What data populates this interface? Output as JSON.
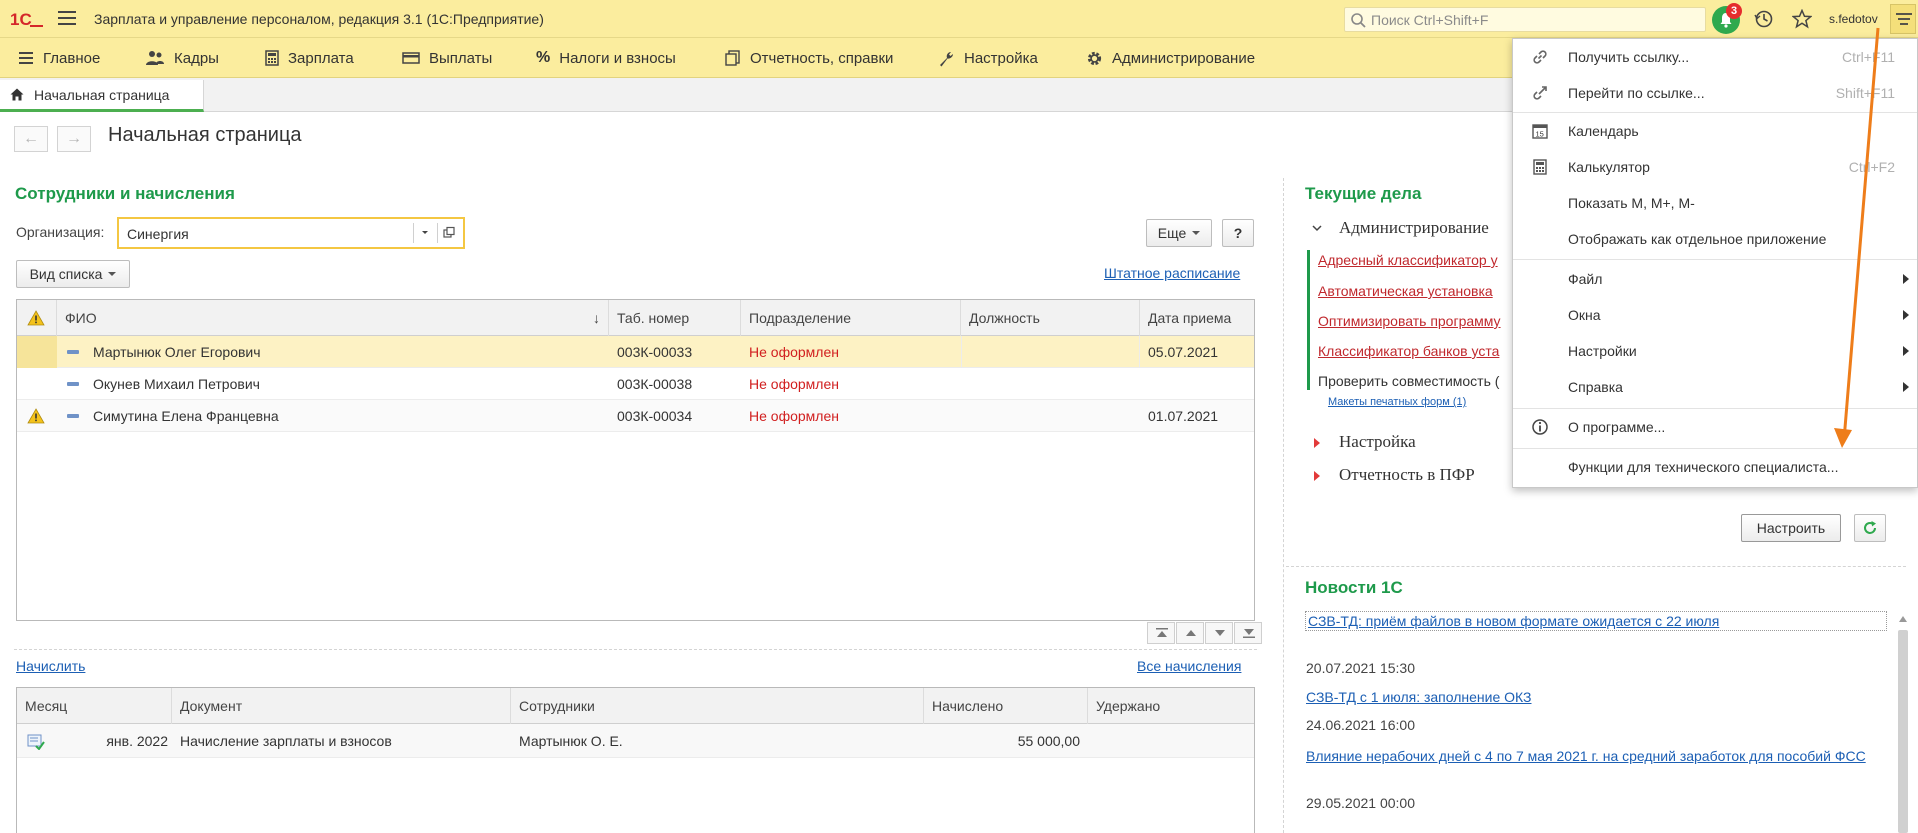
{
  "titlebar": {
    "app_title": "Зарплата и управление персоналом, редакция 3.1  (1С:Предприятие)",
    "search_placeholder": "Поиск Ctrl+Shift+F",
    "notifications_count": "3",
    "username": "s.fedotov"
  },
  "sections": [
    {
      "label": "Главное",
      "icon": "menu-lines-icon"
    },
    {
      "label": "Кадры",
      "icon": "people-icon"
    },
    {
      "label": "Зарплата",
      "icon": "calculator-icon"
    },
    {
      "label": "Выплаты",
      "icon": "card-icon"
    },
    {
      "label": "Налоги и взносы",
      "icon": "percent-icon"
    },
    {
      "label": "Отчетность, справки",
      "icon": "documents-icon"
    },
    {
      "label": "Настройка",
      "icon": "wrench-icon"
    },
    {
      "label": "Администрирование",
      "icon": "gear-icon"
    }
  ],
  "tab": {
    "label": "Начальная страница"
  },
  "page": {
    "title": "Начальная страница"
  },
  "employees": {
    "section_title": "Сотрудники и начисления",
    "org_label": "Организация:",
    "org_value": "Синергия",
    "more_label": "Еще",
    "help_label": "?",
    "view_label": "Вид списка",
    "staff_link": "Штатное расписание",
    "columns": [
      "ФИО",
      "Таб. номер",
      "Подразделение",
      "Должность",
      "Дата приема"
    ],
    "sort_indicator": "↓",
    "rows": [
      {
        "name": "Мартынюк Олег Егорович",
        "tab": "003К-00033",
        "dept": "Не оформлен",
        "position": "",
        "date": "05.07.2021",
        "warning": false
      },
      {
        "name": "Окунев Михаил Петрович",
        "tab": "003К-00038",
        "dept": "Не оформлен",
        "position": "",
        "date": "",
        "warning": false
      },
      {
        "name": "Симутина Елена Францевна",
        "tab": "003К-00034",
        "dept": "Не оформлен",
        "position": "",
        "date": "01.07.2021",
        "warning": true
      }
    ]
  },
  "accruals": {
    "accrue_link": "Начислить",
    "all_link": "Все начисления",
    "columns": [
      "Месяц",
      "Документ",
      "Сотрудники",
      "Начислено",
      "Удержано"
    ],
    "rows": [
      {
        "month": "янв. 2022",
        "document": "Начисление зарплаты и взносов",
        "employees": "Мартынюк О. Е.",
        "accrued": "55 000,00",
        "withheld": ""
      }
    ]
  },
  "tasks": {
    "section_title": "Текущие дела",
    "admin_group": "Администрирование",
    "admin_items": [
      "Адресный классификатор у",
      "Автоматическая установка",
      "Оптимизировать программу",
      "Классификатор банков уста"
    ],
    "check_compat": "Проверить совместимость (",
    "print_forms": "Макеты печатных форм (1)",
    "settings_group": "Настройка",
    "pfr_group": "Отчетность в ПФР",
    "configure_label": "Настроить"
  },
  "news": {
    "section_title": "Новости 1С",
    "items": [
      {
        "title": "СЗВ-ТД: приём файлов в новом формате ожидается с 22 июля",
        "date": "20.07.2021 15:30"
      },
      {
        "title": "СЗВ-ТД с 1 июля: заполнение ОКЗ",
        "date": "24.06.2021 16:00"
      },
      {
        "title": "Влияние нерабочих дней с 4 по 7 мая 2021 г. на средний заработок для пособий ФСС",
        "date": "29.05.2021 00:00"
      }
    ]
  },
  "menu": {
    "items": [
      {
        "label": "Получить ссылку...",
        "shortcut": "Ctrl+F11",
        "icon": "link-icon"
      },
      {
        "label": "Перейти по ссылке...",
        "shortcut": "Shift+F11",
        "icon": "goto-link-icon"
      },
      {
        "label": "Календарь",
        "shortcut": "",
        "icon": "calendar-icon"
      },
      {
        "label": "Калькулятор",
        "shortcut": "Ctrl+F2",
        "icon": "calculator-icon"
      },
      {
        "label": "Показать М, М+, М-",
        "shortcut": "",
        "icon": ""
      },
      {
        "label": "Отображать как отдельное приложение",
        "shortcut": "",
        "icon": ""
      },
      {
        "label": "Файл",
        "submenu": true
      },
      {
        "label": "Окна",
        "submenu": true
      },
      {
        "label": "Настройки",
        "submenu": true
      },
      {
        "label": "Справка",
        "submenu": true
      },
      {
        "label": "О программе...",
        "icon": "info-icon"
      },
      {
        "label": "Функции для технического специалиста..."
      }
    ]
  },
  "colors": {
    "accent_green": "#1e9a4b",
    "toolbar_yellow": "#fbed9e",
    "error_red": "#d11f1f",
    "link_blue": "#1c5fb4",
    "annotation_arrow": "#ee7d1a"
  }
}
